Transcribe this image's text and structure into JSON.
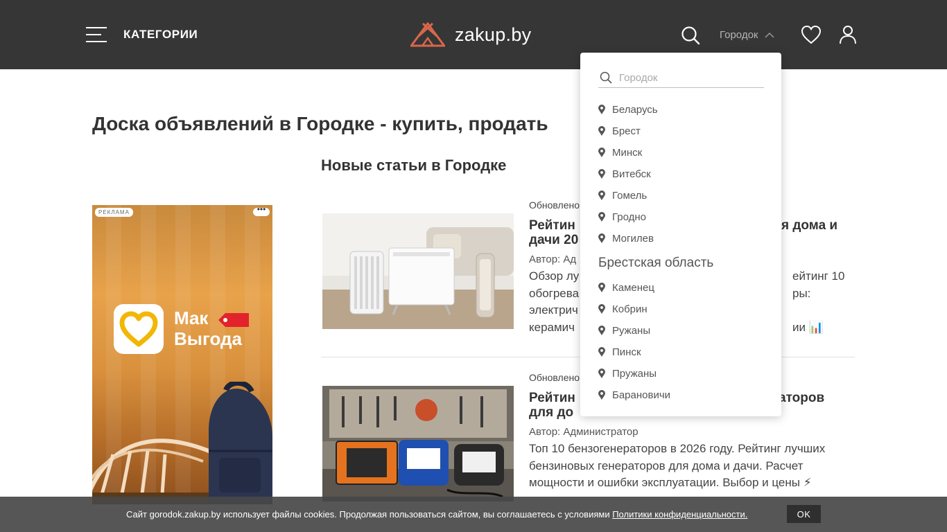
{
  "header": {
    "categories_label": "КАТЕГОРИИ",
    "logo_text": "zakup.by",
    "city_label": "Городок",
    "brand_color": "#d9674a",
    "bg_color": "#363636"
  },
  "page_title": "Доска объявлений в Городке - купить, продать",
  "section_title": "Новые статьи в Городке",
  "ad": {
    "badge": "РЕКЛАМА",
    "more": "•••",
    "brand_line1": "Мак",
    "brand_line2": "Выгода"
  },
  "articles": [
    {
      "meta": "Обновлено",
      "title_line1": "Рейтин",
      "title_line1_end": "я дома и",
      "title_line2": "дачи 20",
      "author": "Автор: Ад",
      "text_lines": [
        "Обзор лу",
        "обогрева",
        "электрич",
        "керамич"
      ],
      "text_ends": [
        "ейтинг 10",
        "ры:",
        "",
        "ии 📊"
      ],
      "image": "heaters-photo"
    },
    {
      "meta": "Обновлено",
      "title_line1": "Рейтин",
      "title_line1_end": "аторов",
      "title_line2": "для до",
      "author": "Автор: Администратор",
      "text_lines": [
        "Топ 10 бензогенераторов в 2026 году. Рейтинг лучших",
        "бензиновых генераторов для дома и дачи. Расчет",
        "мощности и ошибки эксплуатации. Выбор и цены ⚡"
      ],
      "image": "generators-photo"
    }
  ],
  "dropdown": {
    "placeholder": "Городок",
    "cities": [
      "Беларусь",
      "Брест",
      "Минск",
      "Витебск",
      "Гомель",
      "Гродно",
      "Могилев"
    ],
    "group_title": "Брестская область",
    "group_cities": [
      "Каменец",
      "Кобрин",
      "Ружаны",
      "Пинск",
      "Пружаны",
      "Барановичи"
    ]
  },
  "cookie": {
    "text": "Сайт gorodok.zakup.by использует файлы cookies. Продолжая пользоваться сайтом, вы соглашаетесь с условиями ",
    "link": "Политики конфиденциальности.",
    "ok": "OK"
  }
}
